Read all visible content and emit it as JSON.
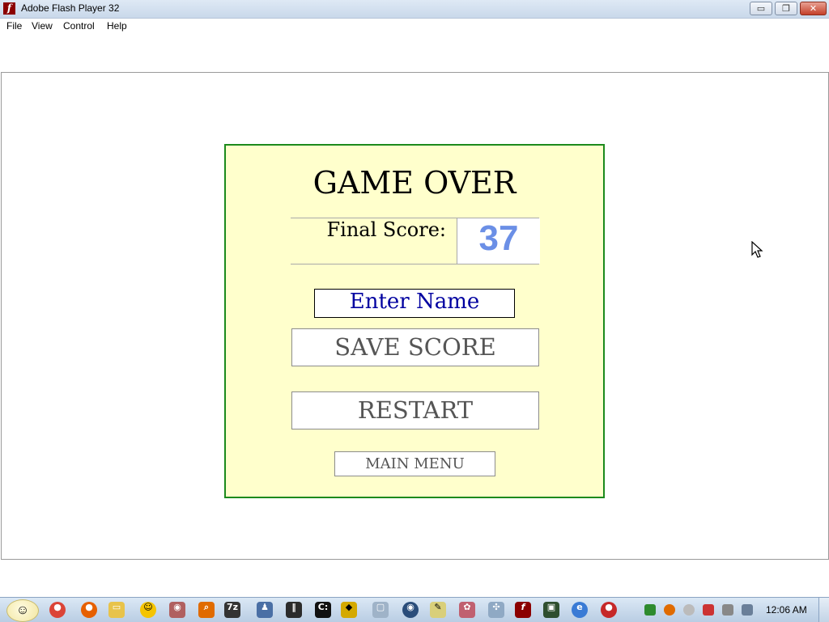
{
  "window": {
    "title": "Adobe Flash Player 32",
    "minimize_glyph": "▭",
    "maximize_glyph": "❐",
    "close_glyph": "✕"
  },
  "menu": {
    "items": [
      "File",
      "View",
      "Control",
      "Help"
    ]
  },
  "game": {
    "title": "GAME OVER",
    "score_label": "Final Score:",
    "score_value": "37",
    "name_input_value": "Enter Name",
    "save_button": "SAVE SCORE",
    "restart_button": "RESTART",
    "main_menu_button": "MAIN MENU"
  },
  "taskbar": {
    "clock": "12:06 AM",
    "apps": [
      "chrome-icon",
      "firefox-icon",
      "folder-icon",
      "messenger-icon",
      "app-icon",
      "search-icon",
      "7zip-icon",
      "network-icon",
      "equalizer-icon",
      "terminal-icon",
      "shield-icon",
      "window-icon",
      "media-icon",
      "notepad-icon",
      "paint-icon",
      "tool-icon",
      "flash-icon",
      "monitor-icon",
      "browser-icon",
      "game-icon"
    ],
    "tray": [
      "battery-icon",
      "search-icon",
      "smiley-icon",
      "network-icon",
      "flag-icon",
      "volume-icon"
    ]
  },
  "colors": {
    "panel_bg": "#ffffcc",
    "panel_border": "#1c8a1c",
    "score_color": "#6b8fe6",
    "input_text": "#0000a0"
  }
}
